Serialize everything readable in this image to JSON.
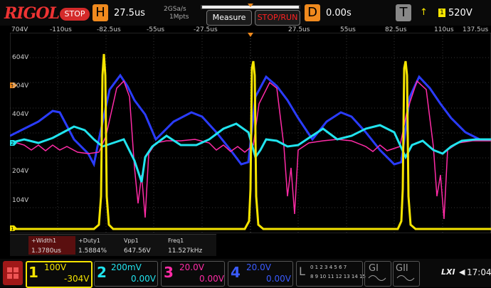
{
  "header": {
    "brand": "RIGOL",
    "run_state": "STOP",
    "horizontal_label": "H",
    "timebase": "27.5us",
    "sample_rate": "2GSa/s",
    "memory_depth": "1Mpts",
    "measure_label": "Measure",
    "stop_run_label": "STOP/RUN",
    "delay_label": "D",
    "delay_value": "0.00s",
    "trigger_label": "T",
    "trigger_source": "1",
    "trigger_level": "520V"
  },
  "scope": {
    "time_labels": [
      "-110us",
      "-82.5us",
      "-55us",
      "-27.5us",
      "27.5us",
      "55us",
      "82.5us",
      "110us",
      "137.5us"
    ],
    "volt_labels": [
      "704V",
      "604V",
      "504V",
      "404V",
      "204V",
      "104V"
    ],
    "ch1_marker": "1",
    "ch2_marker": "2",
    "trigger_marker": "T"
  },
  "measurements": {
    "headers": [
      "+Width1",
      "+Duty1",
      "Vpp1",
      "Freq1"
    ],
    "values": [
      "1.3780us",
      "1.5884%",
      "647.56V",
      "11.527kHz"
    ]
  },
  "channels": [
    {
      "num": "1",
      "scale": "100V",
      "offset": "-304V",
      "color": "#f5e400"
    },
    {
      "num": "2",
      "scale": "200mV",
      "offset": "0.00V",
      "color": "#00e5f0"
    },
    {
      "num": "3",
      "scale": "20.0V",
      "offset": "0.00V",
      "color": "#ff2ba6"
    },
    {
      "num": "4",
      "scale": "20.0V",
      "offset": "0.00V",
      "color": "#3a5bff"
    }
  ],
  "footer": {
    "logic_label": "L",
    "logic_row1": "0 1 2 3 4 5 6 7",
    "logic_row2": "8 9 10 11 12 13 14 15",
    "gen1": "GI",
    "gen2": "GII",
    "lxi": "LXI",
    "time": "17:04"
  },
  "colors": {
    "accent_orange": "#f08a1e",
    "stop_red": "#d42a2a"
  }
}
